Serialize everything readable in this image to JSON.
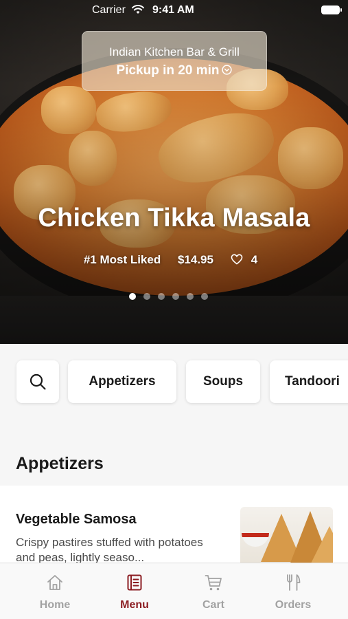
{
  "status_bar": {
    "carrier": "Carrier",
    "time": "9:41 AM"
  },
  "hero": {
    "restaurant": "Indian Kitchen Bar & Grill",
    "pickup": "Pickup in 20 min",
    "dish_name": "Chicken Tikka Masala",
    "badge": "#1 Most Liked",
    "price": "$14.95",
    "likes": "4",
    "carousel": {
      "count": 6,
      "active_index": 0
    }
  },
  "categories": [
    "Appetizers",
    "Soups",
    "Tandoori"
  ],
  "section": {
    "title": "Appetizers",
    "items": [
      {
        "name": "Vegetable Samosa",
        "description": "Crispy pastires stuffed with potatoes and peas, lightly seaso..."
      }
    ]
  },
  "tabbar": {
    "active": "Menu",
    "tabs": [
      {
        "label": "Home",
        "icon": "home-icon"
      },
      {
        "label": "Menu",
        "icon": "menu-book-icon"
      },
      {
        "label": "Cart",
        "icon": "cart-icon"
      },
      {
        "label": "Orders",
        "icon": "fork-knife-icon"
      }
    ]
  },
  "colors": {
    "accent": "#8c1d22",
    "inactive_tab": "#a2a2a2"
  }
}
